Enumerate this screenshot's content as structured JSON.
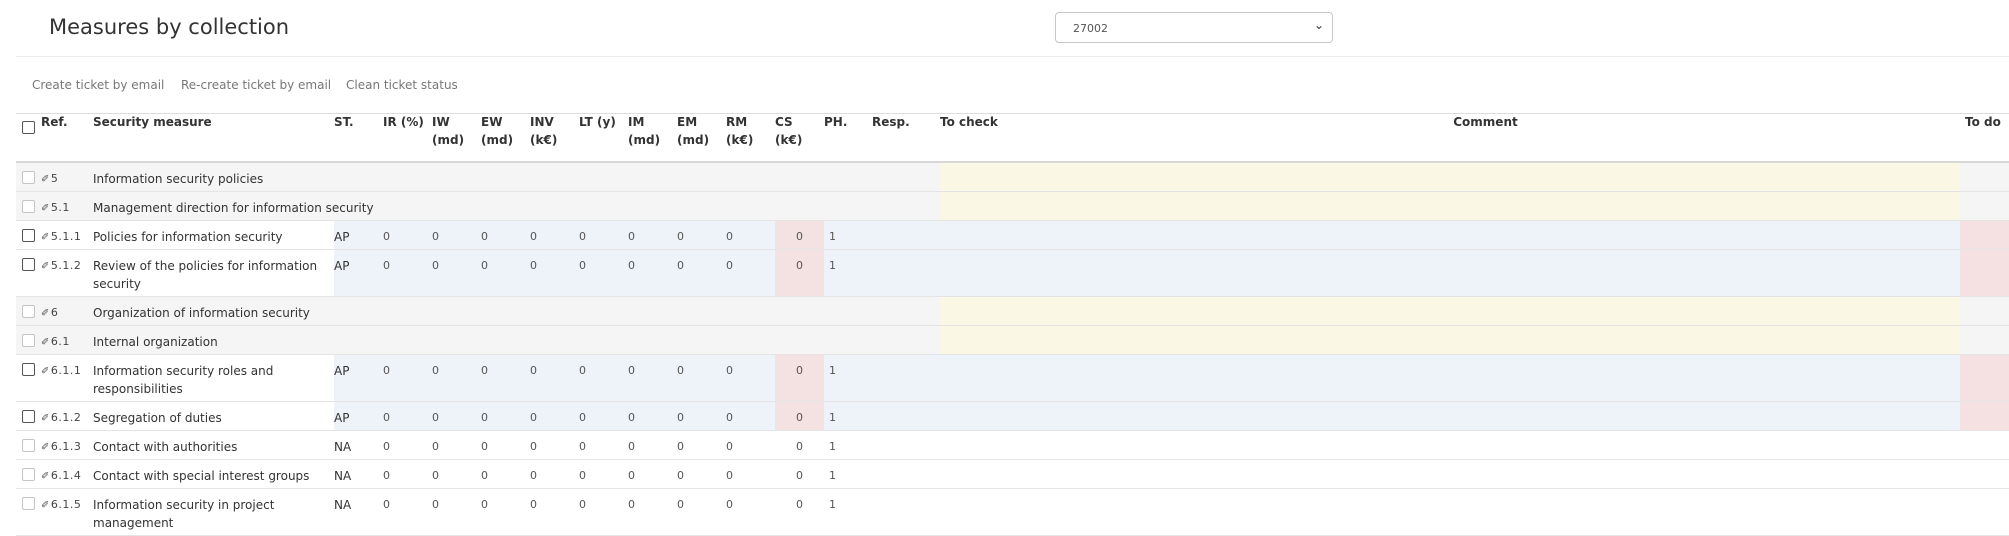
{
  "page": {
    "title": "Measures by collection"
  },
  "collection_select": {
    "value": "27002",
    "chevron_icon": "chevron-down-icon"
  },
  "toolbar": {
    "create_ticket": "Create ticket by email",
    "recreate_ticket": "Re-create ticket by email",
    "clean_status": "Clean ticket status"
  },
  "columns": {
    "ref": "Ref.",
    "measure": "Security measure",
    "st": "ST.",
    "ir": "IR (%)",
    "iw_1": "IW",
    "iw_2": "(md)",
    "ew_1": "EW",
    "ew_2": "(md)",
    "inv_1": "INV",
    "inv_2": "(k€)",
    "lt": "LT (y)",
    "im_1": "IM",
    "im_2": "(md)",
    "em_1": "EM",
    "em_2": "(md)",
    "rm_1": "RM",
    "rm_2": "(k€)",
    "cs_1": "CS",
    "cs_2": "(k€)",
    "ph": "PH.",
    "resp": "Resp.",
    "to_check": "To check",
    "comment": "Comment",
    "to_do": "To do"
  },
  "ref_icon": "pen-edit-icon",
  "rows": [
    {
      "type": "group",
      "ref": "5",
      "measure": "Information security policies"
    },
    {
      "type": "group",
      "ref": "5.1",
      "measure": "Management direction for information security"
    },
    {
      "type": "ap",
      "ref": "5.1.1",
      "measure": "Policies for information security",
      "st": "AP",
      "ir": "0",
      "iw": "0",
      "ew": "0",
      "inv": "0",
      "lt": "0",
      "im": "0",
      "em": "0",
      "rm": "0",
      "cs": "0",
      "ph": "1"
    },
    {
      "type": "ap",
      "ref": "5.1.2",
      "measure": "Review of the policies for information security",
      "st": "AP",
      "ir": "0",
      "iw": "0",
      "ew": "0",
      "inv": "0",
      "lt": "0",
      "im": "0",
      "em": "0",
      "rm": "0",
      "cs": "0",
      "ph": "1"
    },
    {
      "type": "group",
      "ref": "6",
      "measure": "Organization of information security"
    },
    {
      "type": "group",
      "ref": "6.1",
      "measure": "Internal organization"
    },
    {
      "type": "ap",
      "ref": "6.1.1",
      "measure": "Information security roles and responsibilities",
      "st": "AP",
      "ir": "0",
      "iw": "0",
      "ew": "0",
      "inv": "0",
      "lt": "0",
      "im": "0",
      "em": "0",
      "rm": "0",
      "cs": "0",
      "ph": "1"
    },
    {
      "type": "ap",
      "ref": "6.1.2",
      "measure": "Segregation of duties",
      "st": "AP",
      "ir": "0",
      "iw": "0",
      "ew": "0",
      "inv": "0",
      "lt": "0",
      "im": "0",
      "em": "0",
      "rm": "0",
      "cs": "0",
      "ph": "1"
    },
    {
      "type": "na",
      "ref": "6.1.3",
      "measure": "Contact with authorities",
      "st": "NA",
      "ir": "0",
      "iw": "0",
      "ew": "0",
      "inv": "0",
      "lt": "0",
      "im": "0",
      "em": "0",
      "rm": "0",
      "cs": "0",
      "ph": "1"
    },
    {
      "type": "na",
      "ref": "6.1.4",
      "measure": "Contact with special interest groups",
      "st": "NA",
      "ir": "0",
      "iw": "0",
      "ew": "0",
      "inv": "0",
      "lt": "0",
      "im": "0",
      "em": "0",
      "rm": "0",
      "cs": "0",
      "ph": "1"
    },
    {
      "type": "na",
      "ref": "6.1.5",
      "measure": "Information security in project management",
      "st": "NA",
      "ir": "0",
      "iw": "0",
      "ew": "0",
      "inv": "0",
      "lt": "0",
      "im": "0",
      "em": "0",
      "rm": "0",
      "cs": "0",
      "ph": "1"
    }
  ]
}
